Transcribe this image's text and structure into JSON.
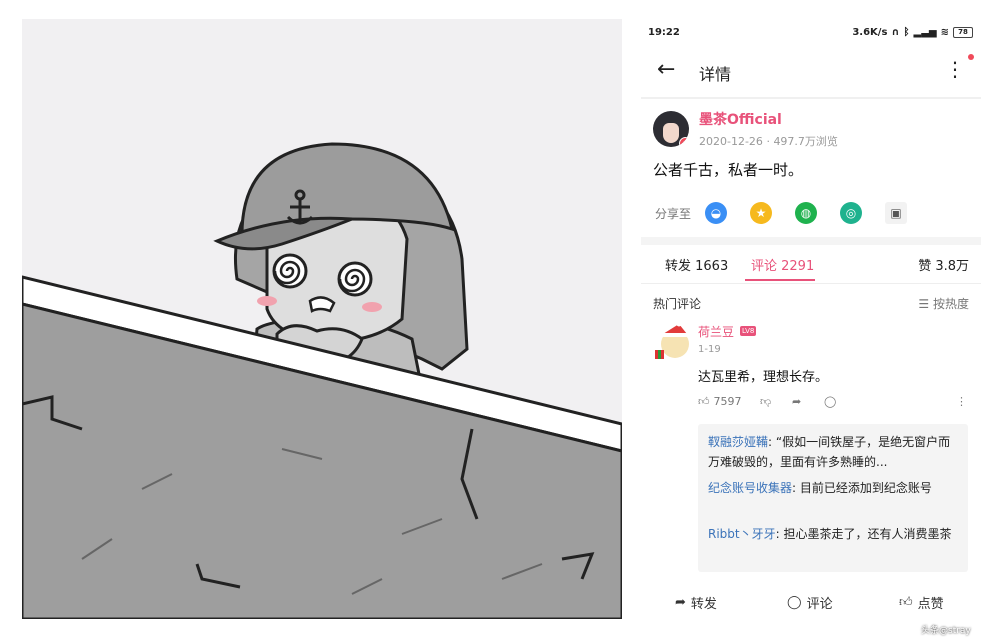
{
  "status": {
    "time": "19:22",
    "network": "3.6K/s",
    "battery": "78"
  },
  "header": {
    "title": "详情"
  },
  "post": {
    "author": "墨茶Official",
    "date": "2020-12-26",
    "views": "497.7万浏览",
    "text": "公者千古，私者一时。",
    "share_label": "分享至",
    "share_icons": [
      "qq-icon",
      "qzone-icon",
      "wechat-icon",
      "moments-icon",
      "gallery-icon"
    ]
  },
  "tabs": {
    "repost": "转发 1663",
    "comments": "评论 2291",
    "likes": "赞 3.8万"
  },
  "comments_section": {
    "hot_label": "热门评论",
    "sort_label": "按热度"
  },
  "comment": {
    "name": "荷兰豆",
    "level": "LV8",
    "date": "1-19",
    "text": "达瓦里希，理想长存。",
    "likes": "7597"
  },
  "replies": [
    {
      "name": "靫融莎娅鞴",
      "text": ": “假如一间铁屋子，是绝无窗户而万难破毁的，里面有许多熟睡的..."
    },
    {
      "name": "纪念账号收集器",
      "text": ": 目前已经添加到纪念账号"
    },
    {
      "name": "Ribbt丶牙牙",
      "text": ": 担心墨茶走了，还有人消费墨茶"
    }
  ],
  "bottom": {
    "repost": "转发",
    "comment": "评论",
    "like": "点赞"
  },
  "watermark": "头条@stray",
  "colors": {
    "accent": "#e8527a",
    "reply_name": "#3b73b9"
  }
}
